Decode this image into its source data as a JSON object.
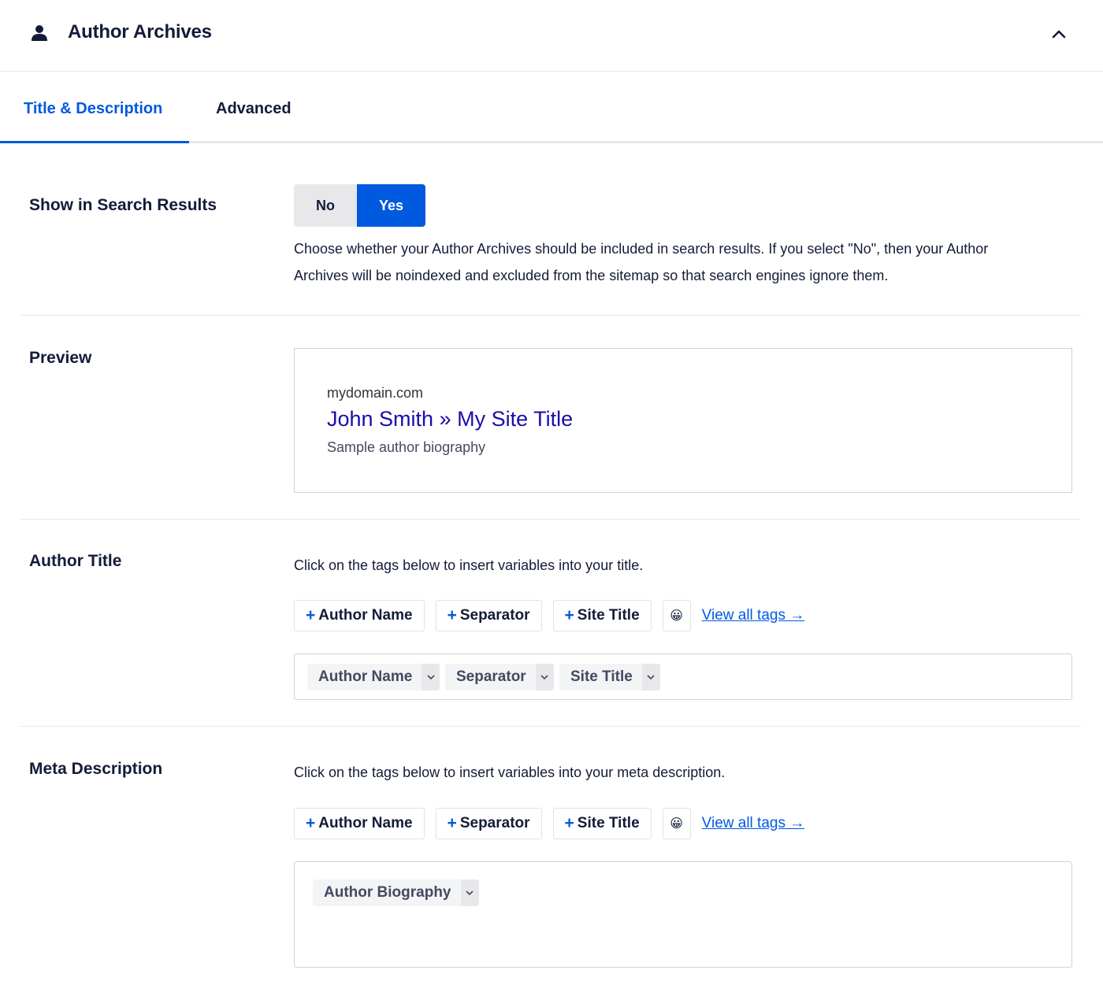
{
  "header": {
    "title": "Author Archives",
    "icon": "user-icon",
    "collapse_icon": "chevron-up-icon"
  },
  "tabs": [
    {
      "label": "Title & Description",
      "active": true
    },
    {
      "label": "Advanced",
      "active": false
    }
  ],
  "colors": {
    "accent": "#005ae0",
    "text": "#141b38",
    "preview_link": "#1a0dab"
  },
  "search_results": {
    "label": "Show in Search Results",
    "options": [
      "No",
      "Yes"
    ],
    "selected": "Yes",
    "help_line1": "Choose whether your Author Archives should be included in search results. If you select \"No\", then your Author",
    "help_line2": "Archives will be noindexed and excluded from the sitemap so that search engines ignore them."
  },
  "preview": {
    "label": "Preview",
    "domain": "mydomain.com",
    "title": "John Smith » My Site Title",
    "description": "Sample author biography"
  },
  "author_title": {
    "label": "Author Title",
    "help": "Click on the tags below to insert variables into your title.",
    "tag_buttons": [
      "Author Name",
      "Separator",
      "Site Title"
    ],
    "emoji_icon": "smiley-emoji",
    "emoji": "😀",
    "view_all": "View all tags →",
    "tokens": [
      "Author Name",
      "Separator",
      "Site Title"
    ]
  },
  "meta_description": {
    "label": "Meta Description",
    "help": "Click on the tags below to insert variables into your meta description.",
    "tag_buttons": [
      "Author Name",
      "Separator",
      "Site Title"
    ],
    "emoji": "😀",
    "view_all": "View all tags →",
    "tokens": [
      "Author Biography"
    ]
  }
}
